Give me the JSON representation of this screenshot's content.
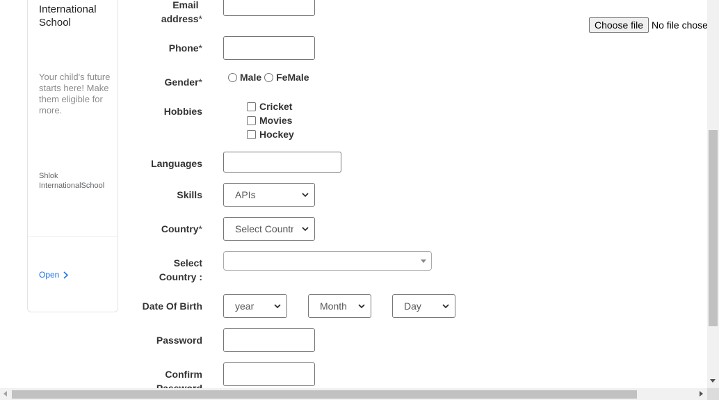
{
  "ad": {
    "title": "International School",
    "description": "Your child's future starts here! Make them eligible for more.",
    "advertiser": "Shlok InternationalSchool",
    "open_label": "Open"
  },
  "form": {
    "email_label": "Email address",
    "phone_label": "Phone",
    "required_mark": "*",
    "gender_label": "Gender",
    "gender_options": [
      "Male",
      "FeMale"
    ],
    "hobbies_label": "Hobbies",
    "hobbies": [
      "Cricket",
      "Movies",
      "Hockey"
    ],
    "languages_label": "Languages",
    "skills_label": "Skills",
    "skills_selected": "APIs",
    "country_label": "Country",
    "country_selected": "Select Countr",
    "select_country_label": "Select Country :",
    "dob_label": "Date Of Birth",
    "dob_year": "year",
    "dob_month": "Month",
    "dob_day": "Day",
    "password_label": "Password",
    "confirm_password_label": "Confirm Password"
  },
  "upload": {
    "choose_file_label": "Choose file",
    "no_file_text": "No file chosen",
    "icon": "gear-icon",
    "icon_color": "#1a86d0"
  }
}
